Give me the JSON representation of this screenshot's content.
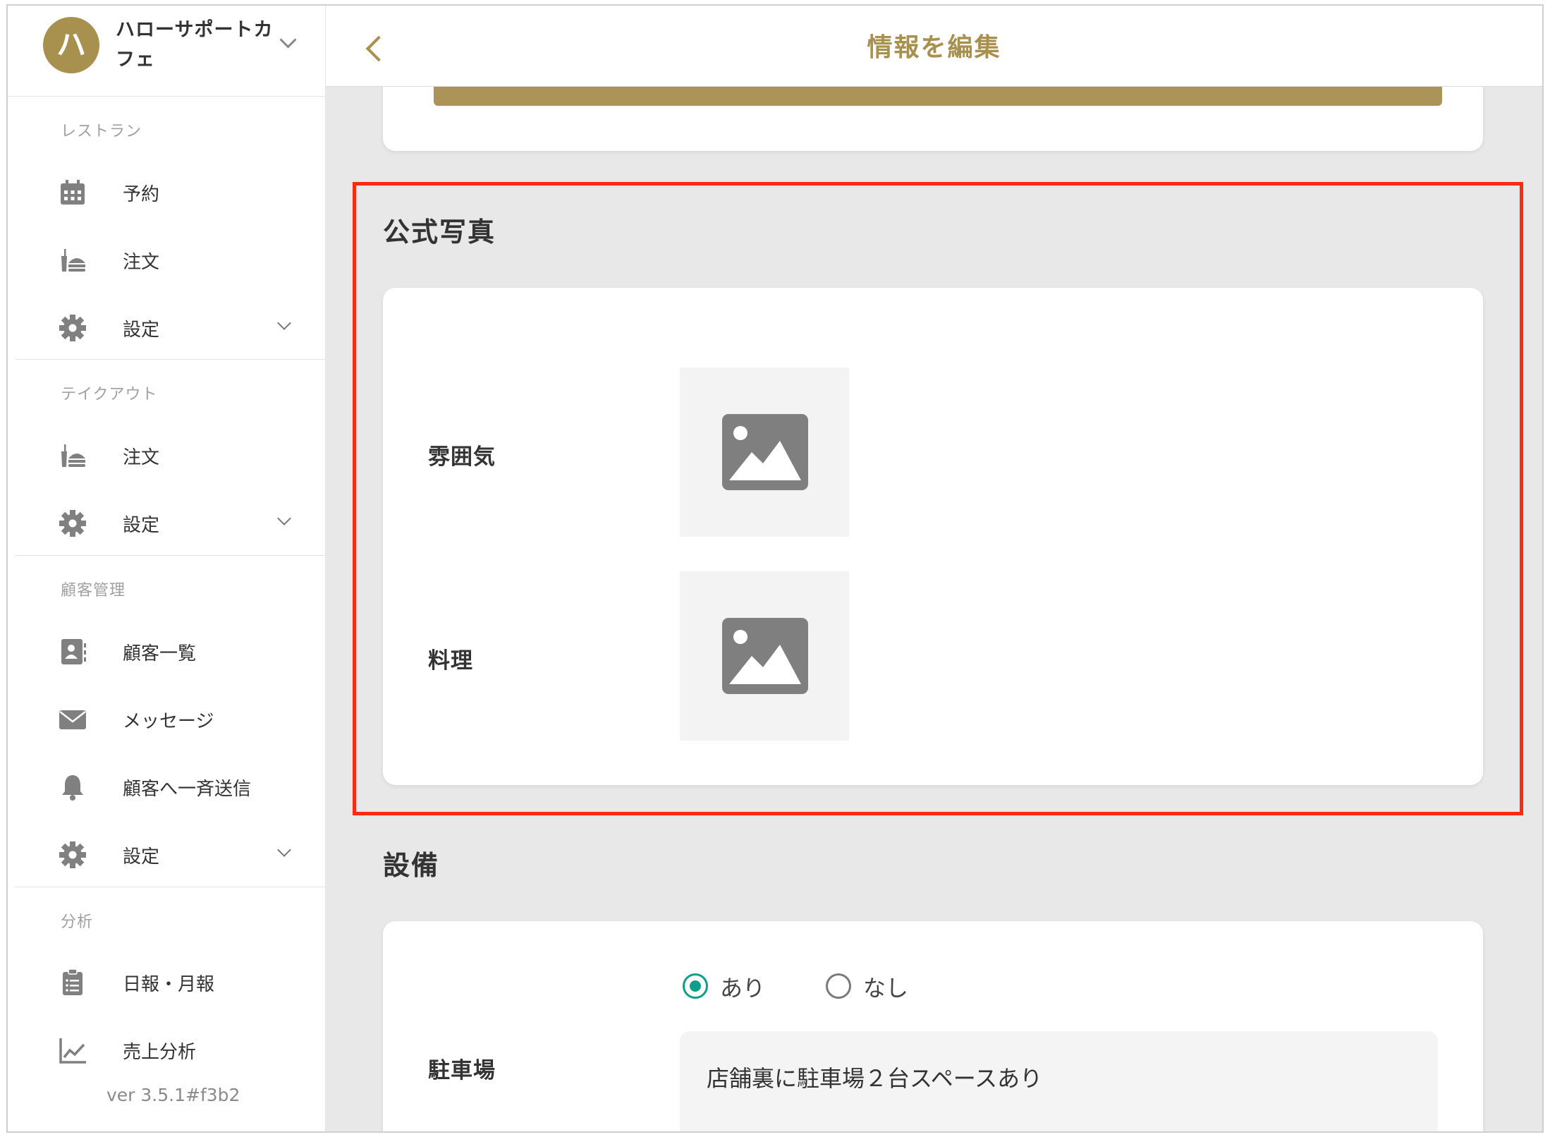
{
  "sidebar": {
    "store_initial": "ハ",
    "store_name": "ハローサポートカフェ",
    "sections": {
      "restaurant": "レストラン",
      "takeout": "テイクアウト",
      "customers": "顧客管理",
      "analytics": "分析"
    },
    "items": {
      "reservation": "予約",
      "order": "注文",
      "settings": "設定",
      "takeout_order": "注文",
      "takeout_settings": "設定",
      "customer_list": "顧客一覧",
      "message": "メッセージ",
      "broadcast": "顧客へ一斉送信",
      "customer_settings": "設定",
      "daily_monthly": "日報・月報",
      "sales_analysis": "売上分析"
    },
    "version": "ver 3.5.1#f3b2"
  },
  "header": {
    "title": "情報を編集"
  },
  "photos": {
    "section_title": "公式写真",
    "atmosphere_label": "雰囲気",
    "food_label": "料理"
  },
  "facilities": {
    "section_title": "設備",
    "parking_label": "駐車場",
    "option_yes": "あり",
    "option_no": "なし",
    "selected": "あり",
    "parking_note": "店舗裏に駐車場２台スペースあり"
  },
  "colors": {
    "accent": "#a8904f",
    "highlight": "#ff2a10",
    "radio_selected": "#0f9e86"
  }
}
